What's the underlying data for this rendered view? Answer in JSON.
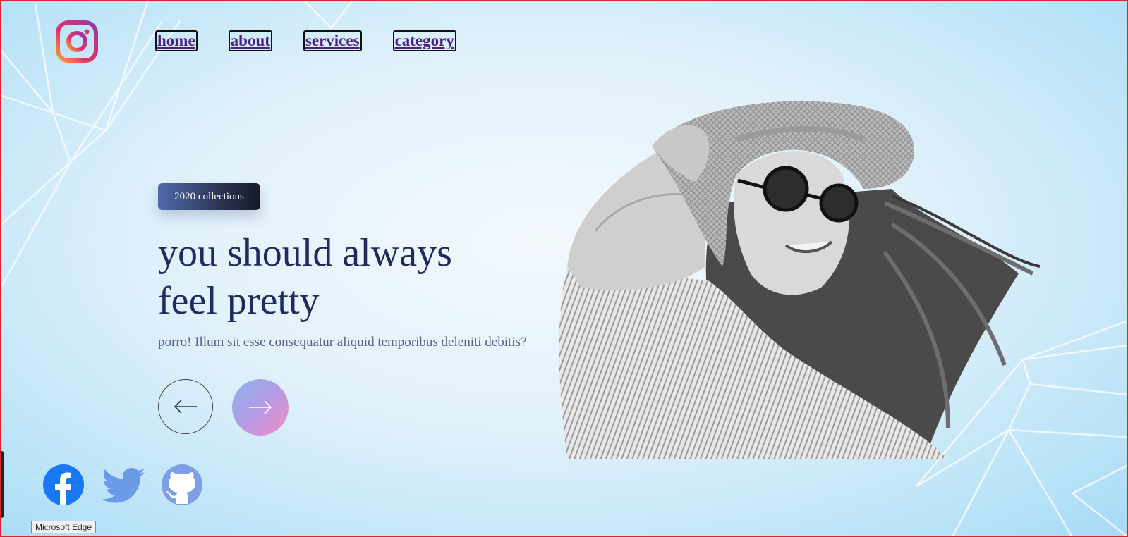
{
  "nav": {
    "items": [
      {
        "label": "home"
      },
      {
        "label": "about"
      },
      {
        "label": "services"
      },
      {
        "label": "category"
      }
    ]
  },
  "hero": {
    "badge": "2020 collections",
    "headline_line1": "you should always",
    "headline_line2": "feel pretty",
    "subtitle": "porro! Illum sit esse consequatur aliquid temporibus deleniti debitis?"
  },
  "controls": {
    "prev_icon": "arrow-left-icon",
    "next_icon": "arrow-right-icon"
  },
  "social": [
    {
      "icon": "facebook-icon",
      "color": "#1877f2"
    },
    {
      "icon": "twitter-icon",
      "color": "#6b9ae8"
    },
    {
      "icon": "github-icon",
      "color": "#7d9fe6"
    }
  ],
  "brand": {
    "icon": "instagram-icon"
  },
  "tooltip": {
    "text": "Microsoft Edge"
  },
  "colors": {
    "headline": "#1f2b5c",
    "nav_text": "#4b1f86",
    "background": "#dff0fb"
  }
}
